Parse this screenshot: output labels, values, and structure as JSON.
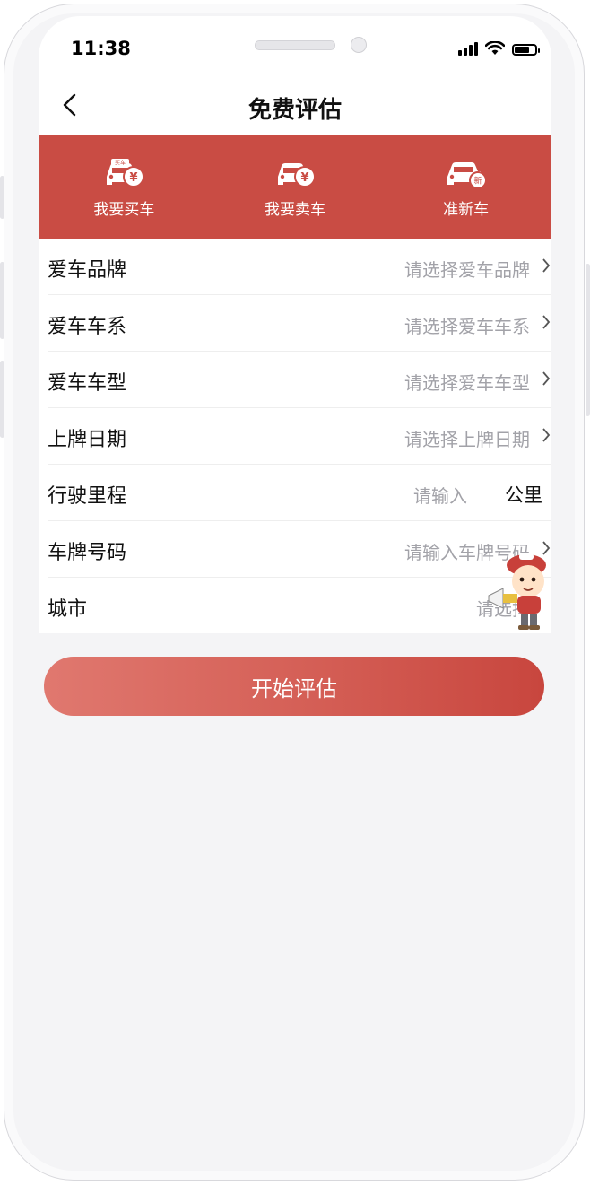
{
  "status_bar": {
    "time": "11:38"
  },
  "nav": {
    "title": "免费评估"
  },
  "tabs": [
    {
      "label": "我要买车",
      "icon": "buy-car-icon",
      "badge": "买车"
    },
    {
      "label": "我要卖车",
      "icon": "sell-car-icon"
    },
    {
      "label": "准新车",
      "icon": "new-car-icon",
      "badge": "新"
    }
  ],
  "form": {
    "rows": [
      {
        "label": "爱车品牌",
        "placeholder": "请选择爱车品牌"
      },
      {
        "label": "爱车车系",
        "placeholder": "请选择爱车车系"
      },
      {
        "label": "爱车车型",
        "placeholder": "请选择爱车车型"
      },
      {
        "label": "上牌日期",
        "placeholder": "请选择上牌日期"
      },
      {
        "label": "行驶里程",
        "placeholder": "请输入",
        "unit": "公里"
      },
      {
        "label": "车牌号码",
        "placeholder": "请输入车牌号码"
      },
      {
        "label": "城市",
        "placeholder": "请选择"
      }
    ]
  },
  "submit": {
    "label": "开始评估"
  },
  "colors": {
    "accent": "#c94c44",
    "button_start": "#e0786f",
    "button_end": "#c8463e"
  }
}
